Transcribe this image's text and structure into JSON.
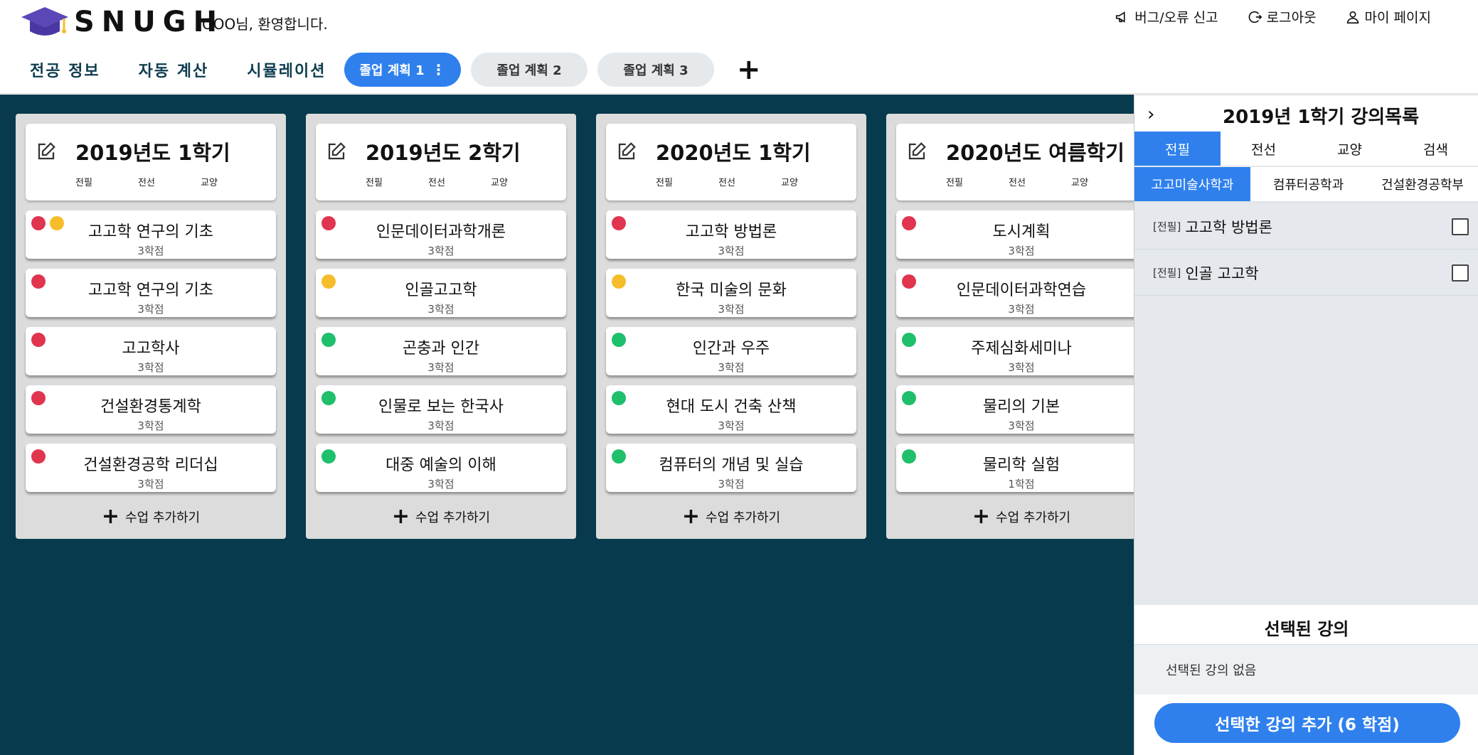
{
  "app": {
    "logo_text": "SNUGH",
    "welcome": "OOO님, 환영합니다."
  },
  "top_links": {
    "report": "버그/오류 신고",
    "logout": "로그아웃",
    "mypage": "마이 페이지"
  },
  "nav": {
    "major_info": "전공 정보",
    "auto_calc": "자동 계산",
    "simulation": "시뮬레이션"
  },
  "plans": [
    {
      "label": "졸업 계획 1",
      "active": true
    },
    {
      "label": "졸업 계획 2",
      "active": false
    },
    {
      "label": "졸업 계획 3",
      "active": false
    }
  ],
  "add_plan_symbol": "+",
  "category_labels": {
    "major_required": "전필",
    "major_elective": "전선",
    "general": "교양"
  },
  "add_course_label": "수업 추가하기",
  "semesters": [
    {
      "title": "2019년도 1학기",
      "courses": [
        {
          "name": "고고학 연구의 기초",
          "credit": "3학점",
          "dots": [
            "red",
            "yellow"
          ]
        },
        {
          "name": "고고학 연구의 기초",
          "credit": "3학점",
          "dots": [
            "red"
          ]
        },
        {
          "name": "고고학사",
          "credit": "3학점",
          "dots": [
            "red"
          ]
        },
        {
          "name": "건설환경통계학",
          "credit": "3학점",
          "dots": [
            "red"
          ]
        },
        {
          "name": "건설환경공학 리더십",
          "credit": "3학점",
          "dots": [
            "red"
          ]
        }
      ]
    },
    {
      "title": "2019년도 2학기",
      "courses": [
        {
          "name": "인문데이터과학개론",
          "credit": "3학점",
          "dots": [
            "red"
          ]
        },
        {
          "name": "인골고고학",
          "credit": "3학점",
          "dots": [
            "yellow"
          ]
        },
        {
          "name": "곤충과 인간",
          "credit": "3학점",
          "dots": [
            "green"
          ]
        },
        {
          "name": "인물로 보는 한국사",
          "credit": "3학점",
          "dots": [
            "green"
          ]
        },
        {
          "name": "대중 예술의 이해",
          "credit": "3학점",
          "dots": [
            "green"
          ]
        }
      ]
    },
    {
      "title": "2020년도 1학기",
      "courses": [
        {
          "name": "고고학 방법론",
          "credit": "3학점",
          "dots": [
            "red"
          ]
        },
        {
          "name": "한국 미술의 문화",
          "credit": "3학점",
          "dots": [
            "yellow"
          ]
        },
        {
          "name": "인간과 우주",
          "credit": "3학점",
          "dots": [
            "green"
          ]
        },
        {
          "name": "현대 도시 건축 산책",
          "credit": "3학점",
          "dots": [
            "green"
          ]
        },
        {
          "name": "컴퓨터의 개념 및 실습",
          "credit": "3학점",
          "dots": [
            "green"
          ]
        }
      ]
    },
    {
      "title": "2020년도 여름학기",
      "courses": [
        {
          "name": "도시계획",
          "credit": "3학점",
          "dots": [
            "red"
          ]
        },
        {
          "name": "인문데이터과학연습",
          "credit": "3학점",
          "dots": [
            "red"
          ]
        },
        {
          "name": "주제심화세미나",
          "credit": "3학점",
          "dots": [
            "green"
          ]
        },
        {
          "name": "물리의 기본",
          "credit": "3학점",
          "dots": [
            "green"
          ]
        },
        {
          "name": "물리학 실험",
          "credit": "1학점",
          "dots": [
            "green"
          ]
        }
      ]
    }
  ],
  "panel": {
    "chevron": "›",
    "title": "2019년 1학기 강의목록",
    "category_tabs": [
      {
        "label": "전필",
        "active": true
      },
      {
        "label": "전선",
        "active": false
      },
      {
        "label": "교양",
        "active": false
      },
      {
        "label": "검색",
        "active": false
      }
    ],
    "department_tabs": [
      {
        "label": "고고미술사학과",
        "active": true
      },
      {
        "label": "컴퓨터공학과",
        "active": false
      },
      {
        "label": "건설환경공학부",
        "active": false
      }
    ],
    "lectures": [
      {
        "tag": "[전필]",
        "name": "고고학 방법론",
        "checked": false
      },
      {
        "tag": "[전필]",
        "name": "인골 고고학",
        "checked": false
      }
    ],
    "selected_title": "선택된 강의",
    "selected_empty": "선택된 강의 없음",
    "add_selected_label": "선택한 강의 추가 (6 학점)"
  },
  "colors": {
    "accent": "#2f80ed",
    "board_bg": "#073a4c",
    "dot_red": "#e0344f",
    "dot_yellow": "#f6bd2b",
    "dot_green": "#1fbf6b"
  }
}
